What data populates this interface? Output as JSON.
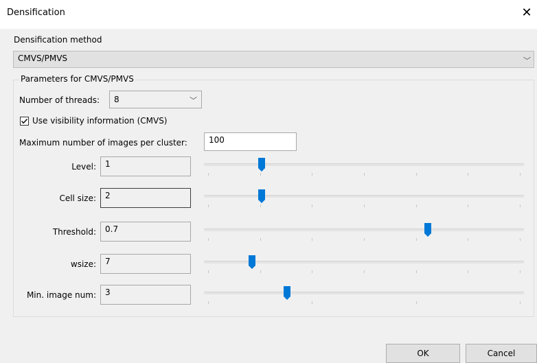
{
  "window": {
    "title": "Densification"
  },
  "method": {
    "group_label": "Densification method",
    "selected": "CMVS/PMVS"
  },
  "params": {
    "group_label": "Parameters for CMVS/PMVS",
    "threads_label": "Number of threads:",
    "threads_value": "8",
    "visibility_label": "Use visibility information (CMVS)",
    "visibility_checked": true,
    "max_images_label": "Maximum number of images per cluster:",
    "max_images_value": "100",
    "sliders": [
      {
        "label": "Level:",
        "value": "1",
        "fraction": 0.18
      },
      {
        "label": "Cell size:",
        "value": "2",
        "fraction": 0.18
      },
      {
        "label": "Threshold:",
        "value": "0.7",
        "fraction": 0.7
      },
      {
        "label": "wsize:",
        "value": "7",
        "fraction": 0.15
      },
      {
        "label": "Min. image num:",
        "value": "3",
        "fraction": 0.26
      }
    ]
  },
  "buttons": {
    "ok": "OK",
    "cancel": "Cancel"
  }
}
